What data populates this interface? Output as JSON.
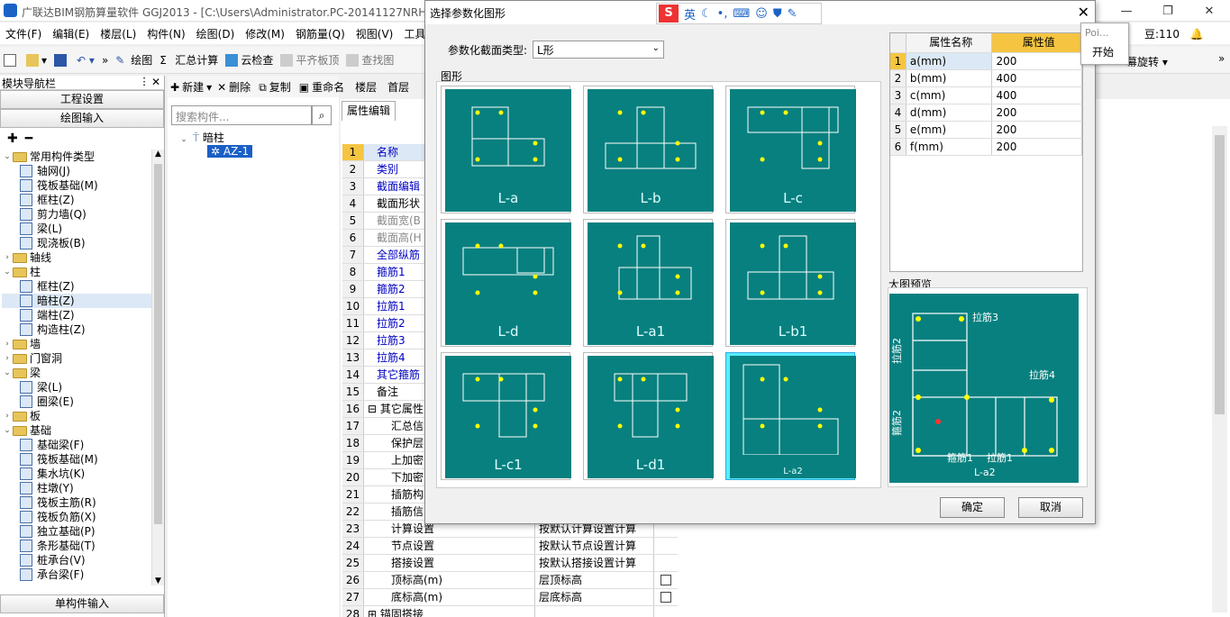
{
  "app": {
    "title": "广联达BIM钢筋算量软件 GGJ2013 - [C:\\Users\\Administrator.PC-20141127NRHM",
    "right_status": "豆:110"
  },
  "menu": [
    "文件(F)",
    "编辑(E)",
    "楼层(L)",
    "构件(N)",
    "绘图(D)",
    "修改(M)",
    "钢筋量(Q)",
    "视图(V)",
    "工具(T)"
  ],
  "toolbar": [
    "绘图",
    "汇总计算",
    "云检查",
    "平齐板顶",
    "查找图",
    "幕旋转"
  ],
  "nav": {
    "title": "模块导航栏",
    "btn_project": "工程设置",
    "btn_draw": "绘图输入",
    "btn_single": "单构件输入",
    "tree": [
      {
        "label": "常用构件类型",
        "level": 0,
        "type": "folder",
        "open": true
      },
      {
        "label": "轴网(J)",
        "level": 1,
        "icon": "grid-icon"
      },
      {
        "label": "筏板基础(M)",
        "level": 1,
        "icon": "raft-icon"
      },
      {
        "label": "框柱(Z)",
        "level": 1,
        "icon": "column-icon"
      },
      {
        "label": "剪力墙(Q)",
        "level": 1,
        "icon": "wall-icon"
      },
      {
        "label": "梁(L)",
        "level": 1,
        "icon": "beam-icon"
      },
      {
        "label": "现浇板(B)",
        "level": 1,
        "icon": "slab-icon"
      },
      {
        "label": "轴线",
        "level": 0,
        "type": "folder",
        "open": false
      },
      {
        "label": "柱",
        "level": 0,
        "type": "folder",
        "open": true
      },
      {
        "label": "框柱(Z)",
        "level": 1,
        "icon": "column-icon"
      },
      {
        "label": "暗柱(Z)",
        "level": 1,
        "icon": "hidden-column-icon",
        "selected": true
      },
      {
        "label": "端柱(Z)",
        "level": 1,
        "icon": "end-column-icon"
      },
      {
        "label": "构造柱(Z)",
        "level": 1,
        "icon": "constructional-column-icon"
      },
      {
        "label": "墙",
        "level": 0,
        "type": "folder",
        "open": false
      },
      {
        "label": "门窗洞",
        "level": 0,
        "type": "folder",
        "open": false
      },
      {
        "label": "梁",
        "level": 0,
        "type": "folder",
        "open": true
      },
      {
        "label": "梁(L)",
        "level": 1,
        "icon": "beam-icon"
      },
      {
        "label": "圈梁(E)",
        "level": 1,
        "icon": "ring-beam-icon"
      },
      {
        "label": "板",
        "level": 0,
        "type": "folder",
        "open": false
      },
      {
        "label": "基础",
        "level": 0,
        "type": "folder",
        "open": true
      },
      {
        "label": "基础梁(F)",
        "level": 1,
        "icon": "foundation-beam-icon"
      },
      {
        "label": "筏板基础(M)",
        "level": 1,
        "icon": "raft-icon"
      },
      {
        "label": "集水坑(K)",
        "level": 1,
        "icon": "sump-icon"
      },
      {
        "label": "柱墩(Y)",
        "level": 1,
        "icon": "pier-icon"
      },
      {
        "label": "筏板主筋(R)",
        "level": 1,
        "icon": "rebar-icon"
      },
      {
        "label": "筏板负筋(X)",
        "level": 1,
        "icon": "rebar-icon"
      },
      {
        "label": "独立基础(P)",
        "level": 1,
        "icon": "footing-icon"
      },
      {
        "label": "条形基础(T)",
        "level": 1,
        "icon": "strip-footing-icon"
      },
      {
        "label": "桩承台(V)",
        "level": 1,
        "icon": "pile-cap-icon"
      },
      {
        "label": "承台梁(F)",
        "level": 1,
        "icon": "cap-beam-icon"
      }
    ]
  },
  "components": {
    "toolbar": [
      "新建",
      "删除",
      "复制",
      "重命名",
      "楼层",
      "首层"
    ],
    "search_placeholder": "搜索构件...",
    "root": "暗柱",
    "child": "AZ-1"
  },
  "props": {
    "tab": "属性编辑",
    "rows": [
      {
        "n": "1",
        "k": "名称",
        "v": "",
        "style": "blue"
      },
      {
        "n": "2",
        "k": "类别",
        "v": "",
        "style": "blue"
      },
      {
        "n": "3",
        "k": "截面编辑",
        "v": "",
        "style": "blue"
      },
      {
        "n": "4",
        "k": "截面形状",
        "v": "",
        "style": ""
      },
      {
        "n": "5",
        "k": "截面宽(B",
        "v": "",
        "style": "gray"
      },
      {
        "n": "6",
        "k": "截面高(H",
        "v": "",
        "style": "gray"
      },
      {
        "n": "7",
        "k": "全部纵筋",
        "v": "",
        "style": "blue"
      },
      {
        "n": "8",
        "k": "箍筋1",
        "v": "",
        "style": "blue"
      },
      {
        "n": "9",
        "k": "箍筋2",
        "v": "",
        "style": "blue"
      },
      {
        "n": "10",
        "k": "拉筋1",
        "v": "",
        "style": "blue"
      },
      {
        "n": "11",
        "k": "拉筋2",
        "v": "",
        "style": "blue"
      },
      {
        "n": "12",
        "k": "拉筋3",
        "v": "",
        "style": "blue"
      },
      {
        "n": "13",
        "k": "拉筋4",
        "v": "",
        "style": "blue"
      },
      {
        "n": "14",
        "k": "其它箍筋",
        "v": "",
        "style": "blue"
      },
      {
        "n": "15",
        "k": "备注",
        "v": "",
        "style": ""
      },
      {
        "n": "16",
        "k": "其它属性",
        "v": "",
        "style": "",
        "group": true
      },
      {
        "n": "17",
        "k": "汇总信",
        "v": "",
        "style": ""
      },
      {
        "n": "18",
        "k": "保护层",
        "v": "",
        "style": ""
      },
      {
        "n": "19",
        "k": "上加密",
        "v": "",
        "style": ""
      },
      {
        "n": "20",
        "k": "下加密",
        "v": "",
        "style": ""
      },
      {
        "n": "21",
        "k": "插筋构",
        "v": "",
        "style": ""
      },
      {
        "n": "22",
        "k": "插筋信",
        "v": "",
        "style": ""
      },
      {
        "n": "23",
        "k": "计算设置",
        "v": "按默认计算设置计算",
        "style": ""
      },
      {
        "n": "24",
        "k": "节点设置",
        "v": "按默认节点设置计算",
        "style": ""
      },
      {
        "n": "25",
        "k": "搭接设置",
        "v": "按默认搭接设置计算",
        "style": ""
      },
      {
        "n": "26",
        "k": "顶标高(m)",
        "v": "层顶标高",
        "style": "",
        "chk": true
      },
      {
        "n": "27",
        "k": "底标高(m)",
        "v": "层底标高",
        "style": "",
        "chk": true
      },
      {
        "n": "28",
        "k": "锚固搭接",
        "v": "",
        "style": "",
        "group": true
      }
    ]
  },
  "dialog": {
    "title": "选择参数化图形",
    "type_label": "参数化截面类型:",
    "type_value": "L形",
    "shapes_label": "图形",
    "shapes": [
      "L-a",
      "L-b",
      "L-c",
      "L-d",
      "L-a1",
      "L-b1",
      "L-c1",
      "L-d1",
      "L-a2"
    ],
    "selected_shape": 8,
    "attr_header_name": "属性名称",
    "attr_header_value": "属性值",
    "attrs": [
      {
        "n": "1",
        "k": "a(mm)",
        "v": "200"
      },
      {
        "n": "2",
        "k": "b(mm)",
        "v": "400"
      },
      {
        "n": "3",
        "k": "c(mm)",
        "v": "400"
      },
      {
        "n": "4",
        "k": "d(mm)",
        "v": "200"
      },
      {
        "n": "5",
        "k": "e(mm)",
        "v": "200"
      },
      {
        "n": "6",
        "k": "f(mm)",
        "v": "200"
      }
    ],
    "preview_label": "大图预览",
    "preview_texts": [
      "拉筋3",
      "拉筋2",
      "拉筋4",
      "箍筋2",
      "箍筋1",
      "拉筋1",
      "L-a2"
    ],
    "ok": "确定",
    "cancel": "取消",
    "ime": [
      "英"
    ]
  },
  "popup": {
    "line1": "Poi...",
    "line2": "开始"
  },
  "colors": {
    "teal": "#08807f",
    "accent": "#1a62c6",
    "header_value": "#f5c542"
  }
}
